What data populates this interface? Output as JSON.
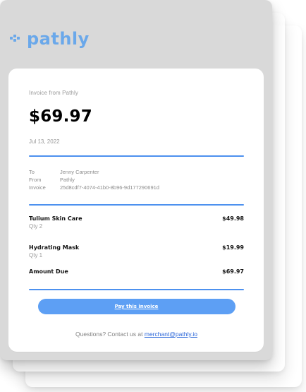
{
  "brand": {
    "logo_text": "pathly",
    "logo_icon": "pathly-logo-icon",
    "color": "#6aa8ea"
  },
  "invoice": {
    "from_label": "Invoice from Pathly",
    "amount": "$69.97",
    "date": "Jul 13, 2022",
    "meta": {
      "to_label": "To",
      "to_value": "Jenny Carpenter",
      "from_label": "From",
      "from_value": "Pathly",
      "invoice_label": "Invoice",
      "invoice_value": "25d8cdf7-4074-41b0-8b96-9d177290691d"
    },
    "items": [
      {
        "name": "Tulium Skin Care",
        "qty": "Qty 2",
        "price": "$49.98"
      },
      {
        "name": "Hydrating Mask",
        "qty": "Qty 1",
        "price": "$19.99"
      }
    ],
    "amount_due_label": "Amount Due",
    "amount_due_value": "$69.97",
    "pay_button_label": "Pay this invoice",
    "questions_text": "Questions? Contact us at ",
    "contact_email": "merchant@pathly.io"
  },
  "colors": {
    "accent": "#4d91ef",
    "button": "#5d9ff4",
    "link": "#2a66d9",
    "header_bg": "#d9d9d9"
  }
}
